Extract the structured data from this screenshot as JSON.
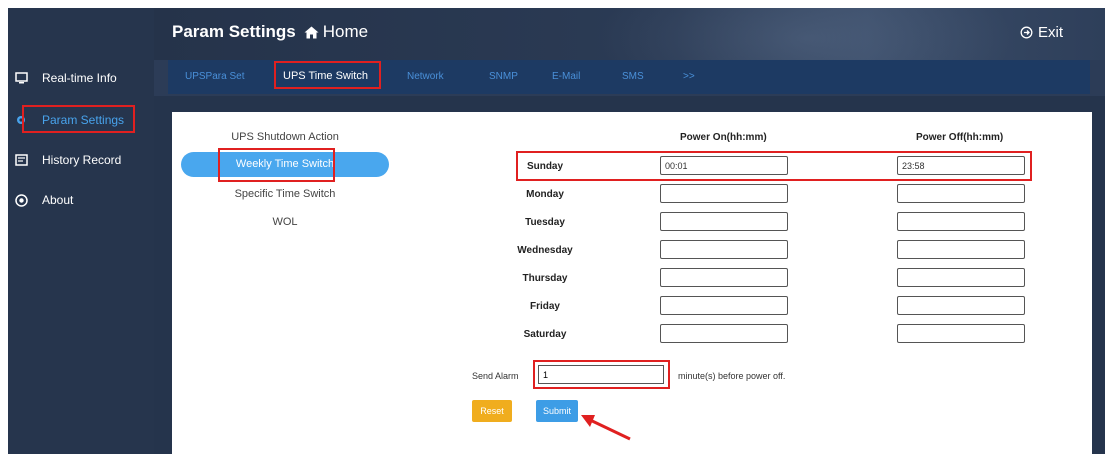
{
  "sidebar": {
    "items": [
      {
        "label": "Real-time Info",
        "icon": "monitor-icon"
      },
      {
        "label": "Param Settings",
        "icon": "gear-icon"
      },
      {
        "label": "History Record",
        "icon": "history-icon"
      },
      {
        "label": "About",
        "icon": "info-circle-icon"
      }
    ]
  },
  "header": {
    "title": "Param Settings",
    "home": "Home",
    "exit": "Exit"
  },
  "tabs": [
    "UPSPara Set",
    "UPS Time Switch",
    "Network",
    "SNMP",
    "E-Mail",
    "SMS",
    ">>"
  ],
  "side_menu": [
    "UPS Shutdown Action",
    "Weekly Time Switch",
    "Specific Time Switch",
    "WOL"
  ],
  "schedule": {
    "power_on_header": "Power On(hh:mm)",
    "power_off_header": "Power Off(hh:mm)",
    "days": [
      {
        "day": "Sunday",
        "on": "00:01",
        "off": "23:58"
      },
      {
        "day": "Monday",
        "on": "",
        "off": ""
      },
      {
        "day": "Tuesday",
        "on": "",
        "off": ""
      },
      {
        "day": "Wednesday",
        "on": "",
        "off": ""
      },
      {
        "day": "Thursday",
        "on": "",
        "off": ""
      },
      {
        "day": "Friday",
        "on": "",
        "off": ""
      },
      {
        "day": "Saturday",
        "on": "",
        "off": ""
      }
    ]
  },
  "alarm": {
    "label": "Send Alarm",
    "value": "1",
    "unit": "minute(s) before power off."
  },
  "buttons": {
    "reset": "Reset",
    "submit": "Submit"
  },
  "colors": {
    "sidebar_bg": "#26354d",
    "accent_blue": "#49a7ee",
    "highlight_red": "#e02020",
    "reset_orange": "#f0ad1e"
  }
}
